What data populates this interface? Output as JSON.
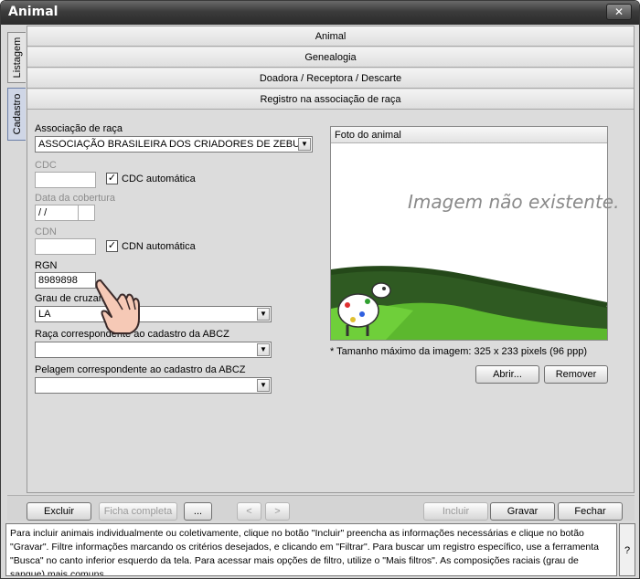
{
  "window": {
    "title": "Animal",
    "close_glyph": "✕"
  },
  "side_tabs": [
    {
      "label": "Listagem"
    },
    {
      "label": "Cadastro"
    }
  ],
  "sections": [
    "Animal",
    "Genealogia",
    "Doadora / Receptora / Descarte",
    "Registro na associação de raça"
  ],
  "form": {
    "associacao_label": "Associação de raça",
    "associacao_value": "ASSOCIAÇÃO BRASILEIRA DOS CRIADORES DE ZEBU",
    "cdc_label": "CDC",
    "cdc_auto_label": "CDC automática",
    "cdc_auto_checked": "✓",
    "data_cobertura_label": "Data da cobertura",
    "data_cobertura_value": " / /",
    "cdn_label": "CDN",
    "cdn_auto_label": "CDN automática",
    "cdn_auto_checked": "✓",
    "rgn_label": "RGN",
    "rgn_value": "8989898",
    "grau_label": "Grau de cruzam",
    "grau_value": "LA",
    "raca_label": "Raça correspondente ao cadastro da ABCZ",
    "raca_value": "",
    "pelagem_label": "Pelagem correspondente ao cadastro da ABCZ",
    "pelagem_value": ""
  },
  "photo": {
    "title": "Foto do animal",
    "placeholder": "Imagem não existente.",
    "note": "* Tamanho máximo da  imagem: 325 x 233 pixels (96 ppp)",
    "open_label": "Abrir...",
    "remove_label": "Remover"
  },
  "bottom_buttons": {
    "excluir": "Excluir",
    "ficha": "Ficha completa",
    "more": "...",
    "prev": "<",
    "next": ">",
    "incluir": "Incluir",
    "gravar": "Gravar",
    "fechar": "Fechar"
  },
  "help": {
    "text": "Para incluir animais individualmente ou coletivamente, clique no botão \"Incluir\" preencha as informações necessárias e clique no botão \"Gravar\". Filtre informações marcando os critérios desejados, e clicando em \"Filtrar\". Para buscar um registro específico, use a ferramenta \"Busca\" no canto inferior esquerdo da tela. Para acessar mais opções de filtro, utilize o \"Mais filtros\". As composições raciais (grau de sangue) mais comuns",
    "q": "?"
  },
  "colors": {
    "titlebar": "#3b3b3b",
    "active_tab": "#cfd6e6",
    "grass": "#5cb82e",
    "hedge": "#2f5a22"
  }
}
